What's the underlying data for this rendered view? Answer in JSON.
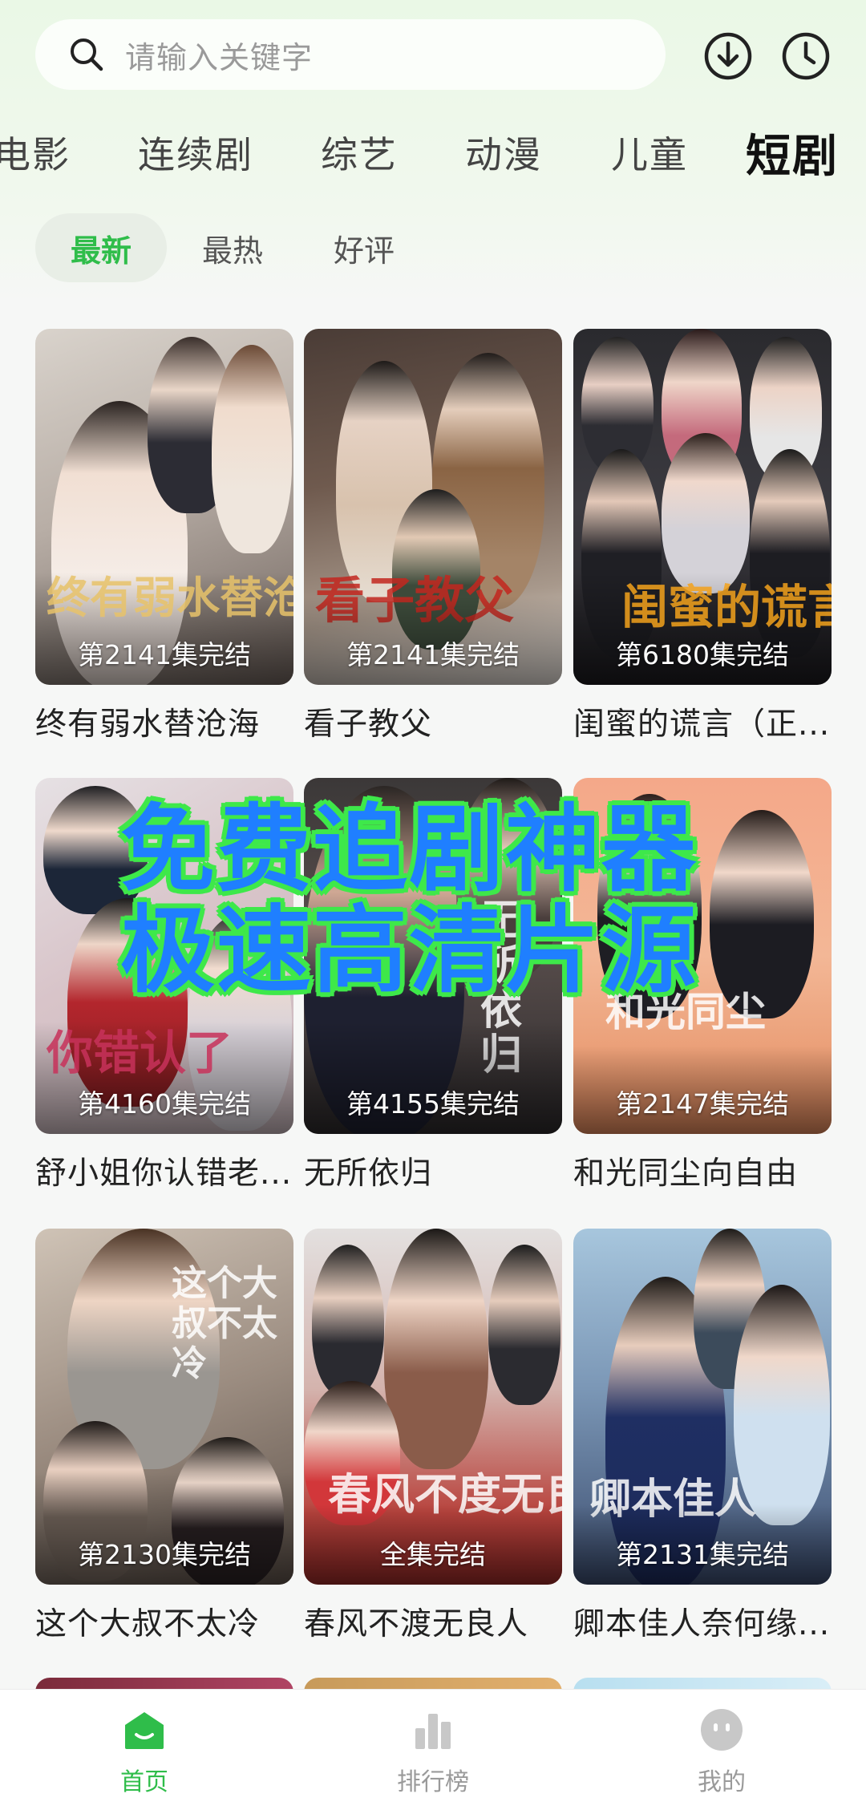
{
  "search": {
    "placeholder": "请输入关键字",
    "icons": [
      "search-icon",
      "download-icon",
      "history-clock-icon"
    ]
  },
  "categories": [
    {
      "label": "电影",
      "active": false
    },
    {
      "label": "连续剧",
      "active": false
    },
    {
      "label": "综艺",
      "active": false
    },
    {
      "label": "动漫",
      "active": false
    },
    {
      "label": "儿童",
      "active": false
    },
    {
      "label": "短剧",
      "active": true
    }
  ],
  "sort_tabs": [
    {
      "label": "最新",
      "active": true
    },
    {
      "label": "最热",
      "active": false
    },
    {
      "label": "好评",
      "active": false
    }
  ],
  "dramas": [
    {
      "title": "终有弱水替沧海",
      "status": "第2141集完结",
      "art": "终有弱水替沧海"
    },
    {
      "title": "看子教父",
      "status": "第2141集完结",
      "art": "看子教父"
    },
    {
      "title": "闺蜜的谎言（正...",
      "status": "第6180集完结",
      "art": "闺蜜的谎言"
    },
    {
      "title": "舒小姐你认错老...",
      "status": "第4160集完结",
      "art": "你错认了"
    },
    {
      "title": "无所依归",
      "status": "第4155集完结",
      "art": "无所依归"
    },
    {
      "title": "和光同尘向自由",
      "status": "第2147集完结",
      "art": "和光同尘"
    },
    {
      "title": "这个大叔不太冷",
      "status": "第2130集完结",
      "art": "这个大叔不太冷"
    },
    {
      "title": "春风不渡无良人",
      "status": "全集完结",
      "art": "春风不度无良人"
    },
    {
      "title": "卿本佳人奈何缘...",
      "status": "第2131集完结",
      "art": "卿本佳人"
    }
  ],
  "promo": {
    "line1": "免费追剧神器",
    "line2": "极速高清片源",
    "colors": {
      "fill": "#1f7fff",
      "outline": "#3ee84a"
    }
  },
  "bottom_nav": [
    {
      "label": "首页",
      "icon": "home-icon",
      "active": true
    },
    {
      "label": "排行榜",
      "icon": "ranking-bars-icon",
      "active": false
    },
    {
      "label": "我的",
      "icon": "profile-face-icon",
      "active": false
    }
  ],
  "colors": {
    "accent": "#2fbd4a",
    "active_text": "#111111",
    "inactive_text": "#9a9a9a"
  }
}
